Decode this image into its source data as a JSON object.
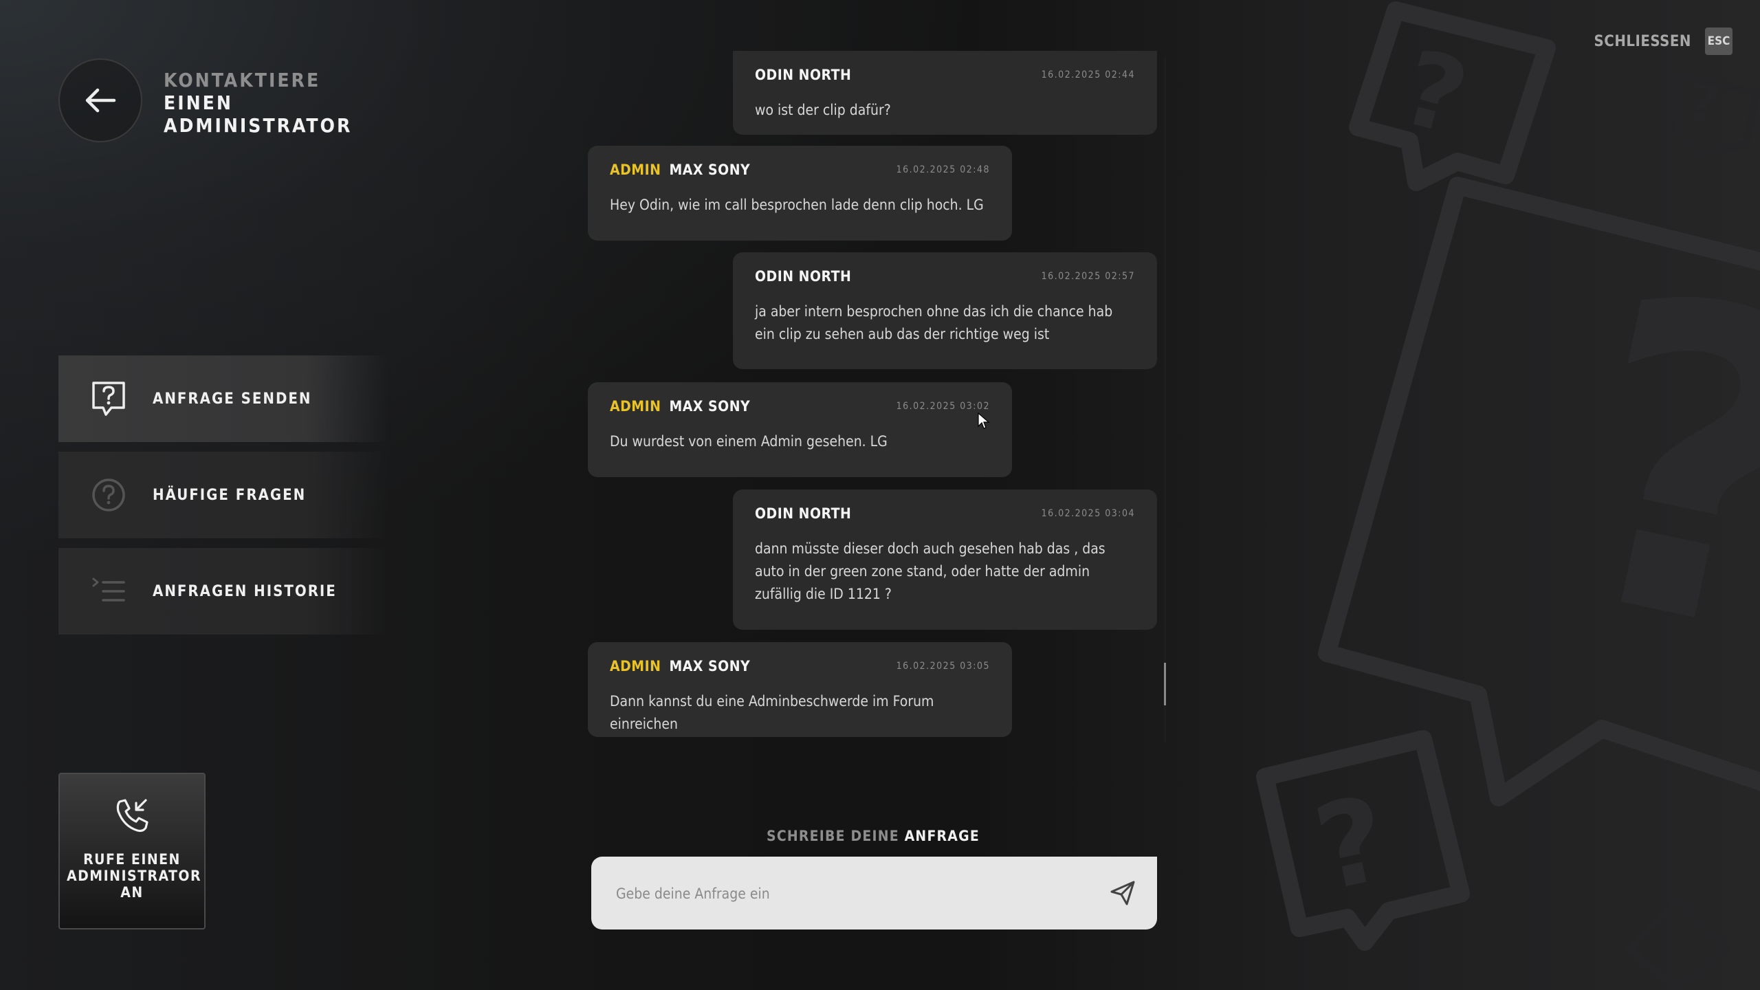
{
  "header": {
    "title_line1": "KONTAKTIERE",
    "title_line2": "EINEN",
    "title_line3": "ADMINISTRATOR",
    "back_icon": "arrow-left-icon",
    "close_label": "SCHLIESSEN",
    "close_key": "ESC"
  },
  "menu": {
    "items": [
      {
        "label": "ANFRAGE SENDEN",
        "icon": "question-bubble-icon",
        "active": true
      },
      {
        "label": "HÄUFIGE FRAGEN",
        "icon": "question-circle-icon",
        "active": false
      },
      {
        "label": "ANFRAGEN HISTORIE",
        "icon": "list-history-icon",
        "active": false
      }
    ]
  },
  "call_button": {
    "label": "RUFE EINEN ADMINISTRATOR AN",
    "icon": "phone-incoming-icon"
  },
  "messages": [
    {
      "role": "",
      "name": "ODIN NORTH",
      "time": "16.02.2025 02:44",
      "text": "wo ist der clip dafür?",
      "side": "user"
    },
    {
      "role": "ADMIN",
      "name": "MAX SONY",
      "time": "16.02.2025 02:48",
      "text": "Hey Odin, wie im call besprochen lade denn clip hoch. LG",
      "side": "admin"
    },
    {
      "role": "",
      "name": "ODIN NORTH",
      "time": "16.02.2025 02:57",
      "text": "ja aber intern besprochen ohne das ich die chance hab ein clip zu sehen aub das der richtige weg ist",
      "side": "user"
    },
    {
      "role": "ADMIN",
      "name": "MAX SONY",
      "time": "16.02.2025 03:02",
      "text": "Du wurdest von einem Admin gesehen. LG",
      "side": "admin"
    },
    {
      "role": "",
      "name": "ODIN NORTH",
      "time": "16.02.2025 03:04",
      "text": "dann müsste dieser doch auch gesehen hab das , das auto in der green zone stand, oder hatte der admin zufällig die ID 1121 ?",
      "side": "user"
    },
    {
      "role": "ADMIN",
      "name": "MAX SONY",
      "time": "16.02.2025 03:05",
      "text": "Dann kannst du eine Adminbeschwerde im Forum einreichen",
      "side": "admin"
    }
  ],
  "composer": {
    "label_dim": "SCHREIBE DEINE",
    "label_bright": "ANFRAGE",
    "placeholder": "Gebe deine Anfrage ein",
    "value": "",
    "send_icon": "send-icon"
  },
  "colors": {
    "admin_accent": "#e8c42a",
    "bubble_bg": "#2b2b2c",
    "input_bg": "#e6e6e6"
  }
}
